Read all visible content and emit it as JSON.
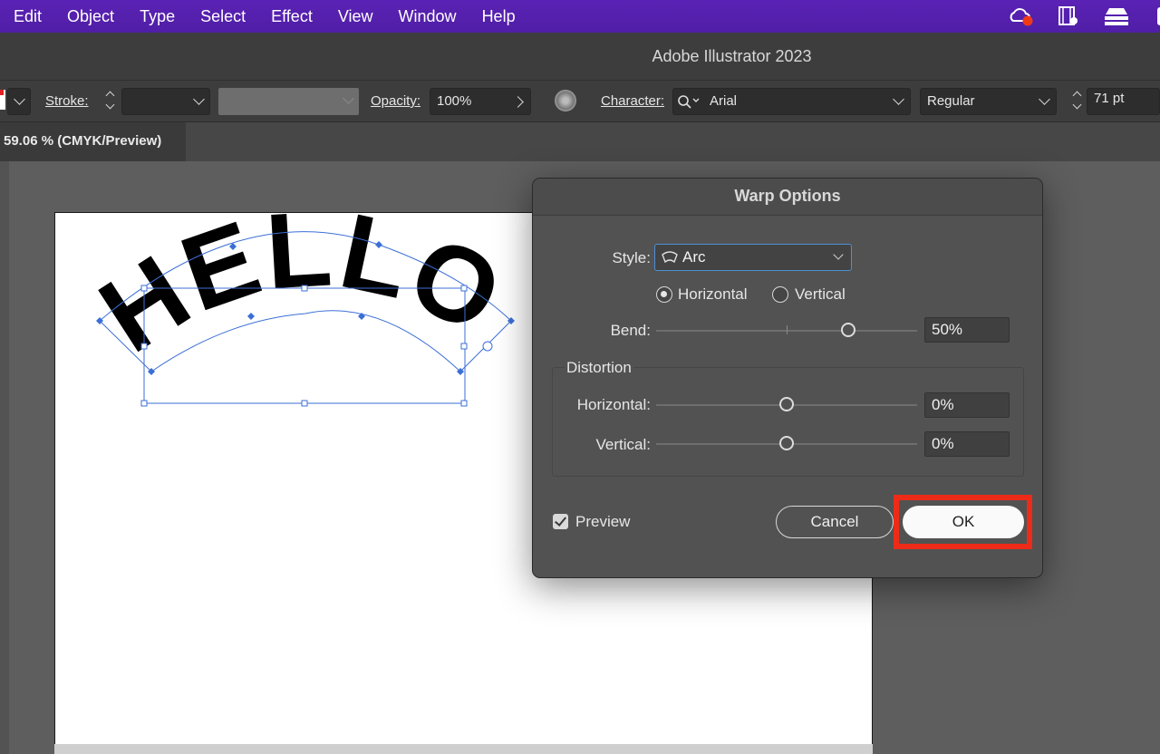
{
  "menubar": {
    "items": [
      "Edit",
      "Object",
      "Type",
      "Select",
      "Effect",
      "View",
      "Window",
      "Help"
    ],
    "tray_icons": [
      "creative-cloud-icon",
      "media-icon",
      "layers-stack-icon",
      "user-profile-icon"
    ]
  },
  "titlebar": {
    "title": "Adobe Illustrator 2023"
  },
  "controlbar": {
    "stroke_label": "Stroke:",
    "opacity_label": "Opacity:",
    "opacity_value": "100%",
    "character_label": "Character:",
    "font_family": "Arial",
    "font_style": "Regular",
    "font_size": "71 pt"
  },
  "document": {
    "tab_label": "59.06 % (CMYK/Preview)"
  },
  "artwork": {
    "text": "HELLO"
  },
  "dialog": {
    "title": "Warp Options",
    "style_label": "Style:",
    "style_value": "Arc",
    "orientation": {
      "horizontal_label": "Horizontal",
      "vertical_label": "Vertical",
      "selected": "Horizontal"
    },
    "bend_label": "Bend:",
    "bend_value": "50%",
    "distortion": {
      "title": "Distortion",
      "horizontal_label": "Horizontal:",
      "horizontal_value": "0%",
      "vertical_label": "Vertical:",
      "vertical_value": "0%"
    },
    "preview_label": "Preview",
    "preview_checked": true,
    "cancel_label": "Cancel",
    "ok_label": "OK",
    "highlight_color": "#ee2b18"
  }
}
